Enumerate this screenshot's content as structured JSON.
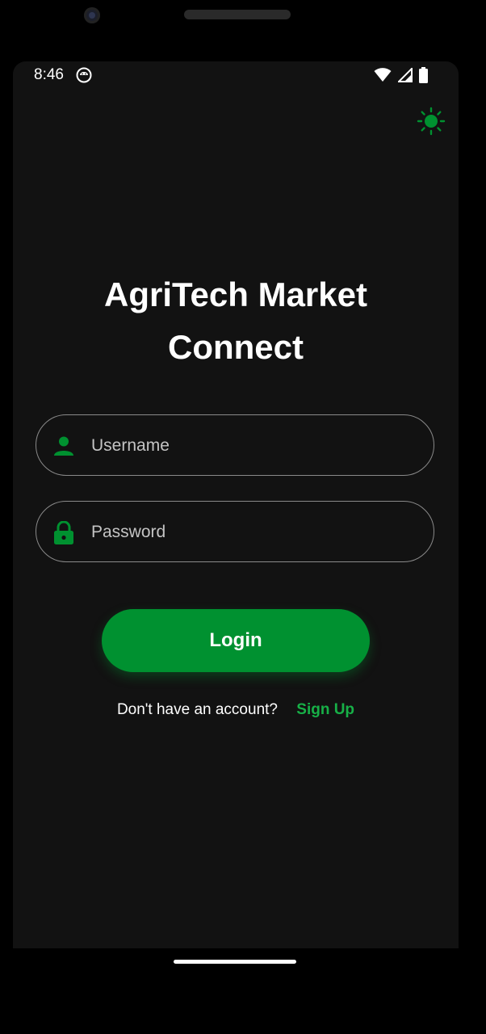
{
  "status_bar": {
    "time": "8:46",
    "app_icon": "android-debug-icon",
    "icons": [
      "wifi-icon",
      "cell-signal-icon",
      "battery-icon"
    ]
  },
  "header": {
    "theme_toggle_icon": "sun-icon"
  },
  "app": {
    "title_line1": "AgriTech Market",
    "title_line2": "Connect"
  },
  "form": {
    "username": {
      "placeholder": "Username",
      "value": "",
      "icon": "person-icon"
    },
    "password": {
      "placeholder": "Password",
      "value": "",
      "icon": "lock-icon"
    },
    "login_label": "Login"
  },
  "signup": {
    "prompt": "Don't have an account?",
    "link_label": "Sign Up"
  },
  "colors": {
    "background": "#121212",
    "accent": "#009130",
    "link": "#17b047"
  }
}
